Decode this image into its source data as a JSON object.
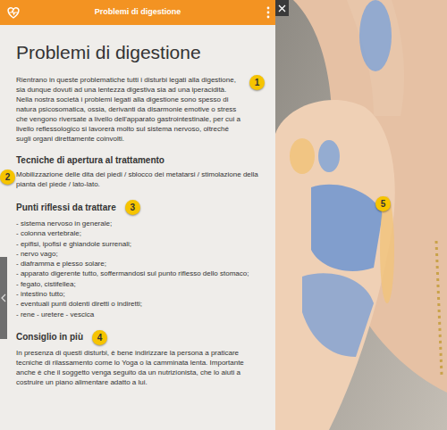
{
  "panel": {
    "title": "Problemi di digestione"
  },
  "article": {
    "heading": "Problemi di digestione",
    "intro": "Rientrano in queste problematiche tutti i disturbi legati alla digestione, sia dunque dovuti ad una lentezza digestiva sia ad una iperacidità. Nella nostra società i problemi legati alla digestione sono spesso di natura psicosomatica, ossia, derivanti da disarmonie emotive o stress che vengono riversate a livello dell'apparato gastrointestinale, per cui a livello reflessologico si lavorerà molto sul sistema nervoso, oltreché sugli organi direttamente coinvolti.",
    "intro_badge": "1",
    "sections": [
      {
        "kind": "tecnica",
        "heading": "Tecniche di apertura al trattamento",
        "badge": "2",
        "body": "Mobilizzazione delle dita dei piedi / sblocco dei metatarsi / stimolazione della pianta del piede / lato-lato."
      },
      {
        "kind": "lista",
        "heading": "Punti riflessi da trattare",
        "badge": "3",
        "items": [
          "- sistema nervoso in generale;",
          "- colonna vertebrale;",
          "- epifisi, ipofisi e ghiandole surrenali;",
          "- nervo vago;",
          "- diaframma e plesso solare;",
          "- apparato digerente tutto, soffermandosi sul punto riflesso dello stomaco;",
          "- fegato, cistifellea;",
          "- intestino tutto;",
          "- eventuali punti dolenti diretti o indiretti;",
          "- rene - uretere - vescica"
        ]
      },
      {
        "kind": "consiglio",
        "heading": "Consiglio in più",
        "badge": "4",
        "body": "In presenza di questi disturbi, è bene indirizzare la persona a praticare tecniche di rilassamento come lo Yoga o la camminata lenta. Importante anche è che il soggetto venga seguito da un nutrizionista, che lo aiuti a costruire un piano alimentare adatto a lui."
      }
    ]
  },
  "viewer": {
    "badge": "5"
  }
}
